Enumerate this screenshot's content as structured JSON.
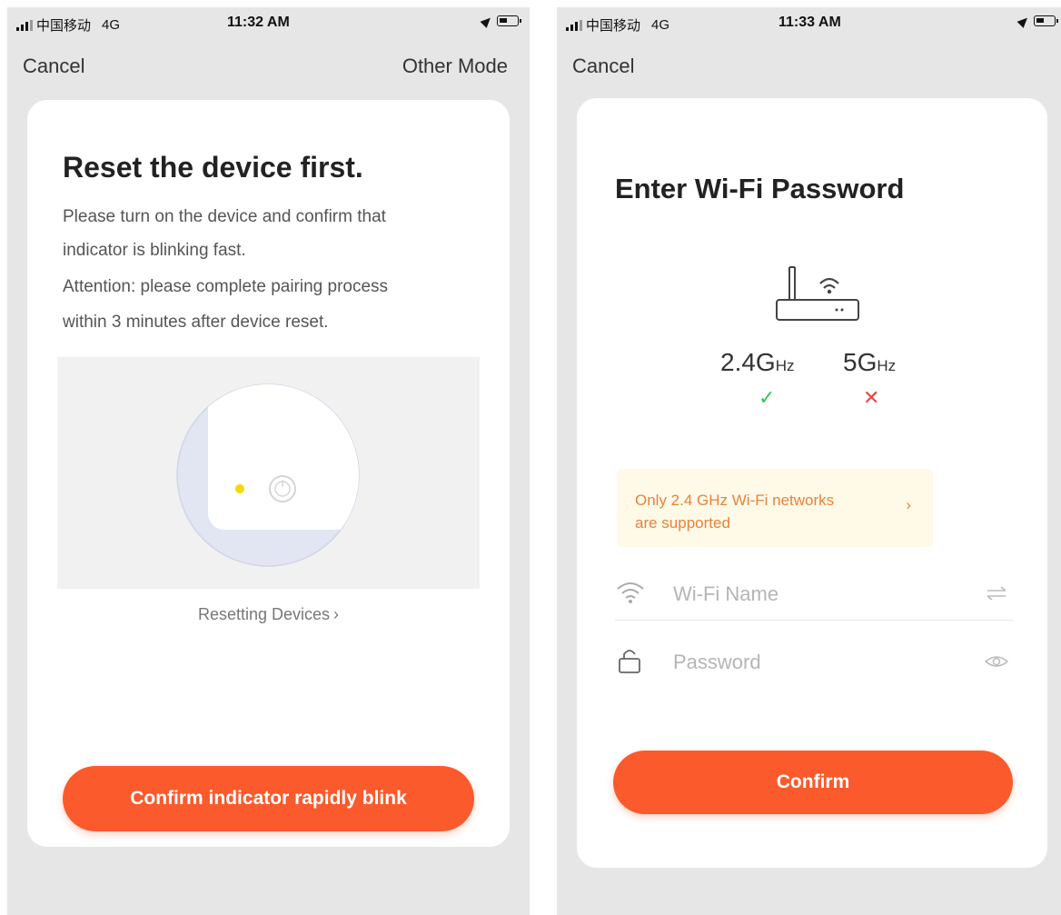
{
  "left": {
    "status": {
      "carrier": "中国移动",
      "network": "4G",
      "time": "11:32 AM"
    },
    "nav": {
      "cancel": "Cancel",
      "other_mode": "Other Mode"
    },
    "title": "Reset the device first.",
    "description_lines": [
      "Please turn on the device and confirm that",
      "indicator is blinking fast.",
      "Attention: please complete pairing process",
      "within 3 minutes after device reset."
    ],
    "resetting_link": "Resetting Devices",
    "resetting_chevron": "›",
    "confirm_button": "Confirm indicator rapidly blink",
    "indicator_color": "#f5d800"
  },
  "right": {
    "status": {
      "carrier": "中国移动",
      "network": "4G",
      "time": "11:33 AM"
    },
    "nav": {
      "cancel": "Cancel"
    },
    "title": "Enter Wi-Fi Password",
    "freq_24": {
      "value": "2.4G",
      "unit": "Hz",
      "mark": "✓"
    },
    "freq_5": {
      "value": "5G",
      "unit": "Hz",
      "mark": "✕"
    },
    "notice_lines": [
      "Only 2.4 GHz Wi-Fi networks",
      "are supported"
    ],
    "notice_chevron": "›",
    "wifi_name_placeholder": "Wi-Fi Name",
    "password_placeholder": "Password",
    "confirm_button": "Confirm"
  },
  "colors": {
    "accent": "#fb5a2c",
    "success": "#3cc058",
    "error": "#ef4444",
    "notice_text": "#e8833a",
    "notice_bg": "#fff9e8"
  }
}
